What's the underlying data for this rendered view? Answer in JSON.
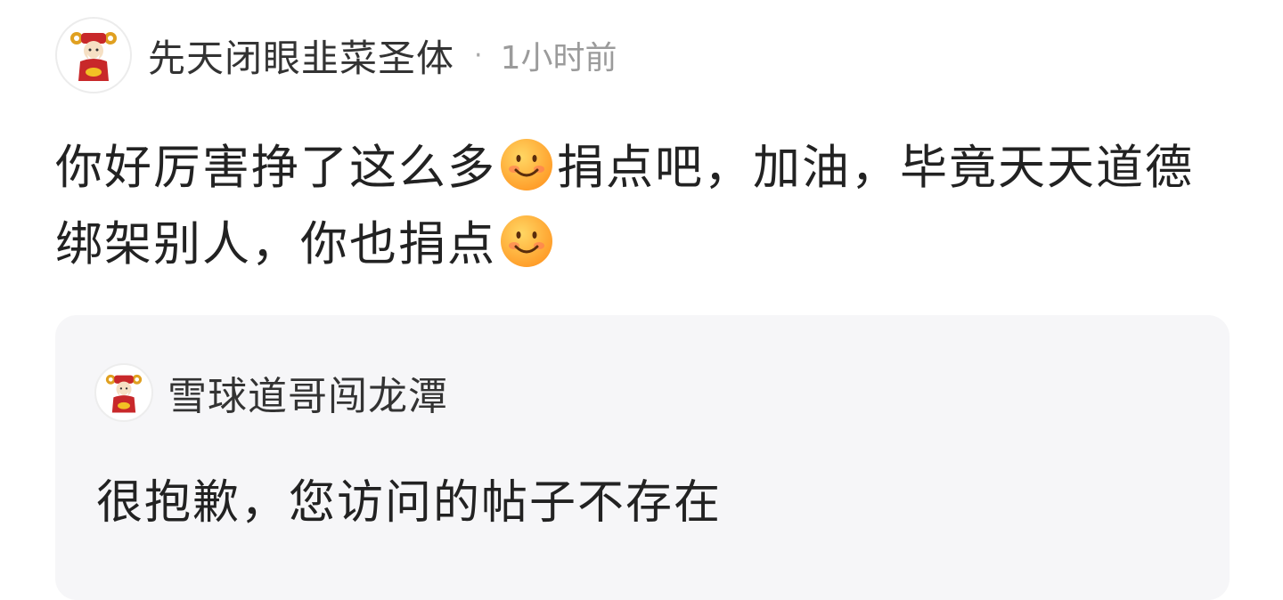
{
  "post": {
    "author": {
      "name": "先天闭眼韭菜圣体",
      "avatar_icon": "caishen-avatar-icon"
    },
    "meta_separator": "·",
    "time": "1小时前",
    "content": {
      "part1": "你好厉害挣了这么多",
      "part2": "捐点吧，加油，毕竟天天道德绑架别人，你也捐点",
      "emoji_icon": "smile-emoji-icon"
    }
  },
  "quote": {
    "author": {
      "name": "雪球道哥闯龙潭",
      "avatar_icon": "caishen-avatar-icon"
    },
    "text": "很抱歉，您访问的帖子不存在"
  },
  "colors": {
    "author_text": "#333333",
    "meta_text": "#9b9b9b",
    "body_text": "#222222",
    "quote_background": "#f6f6f8",
    "emoji_face": "#ffb338"
  }
}
